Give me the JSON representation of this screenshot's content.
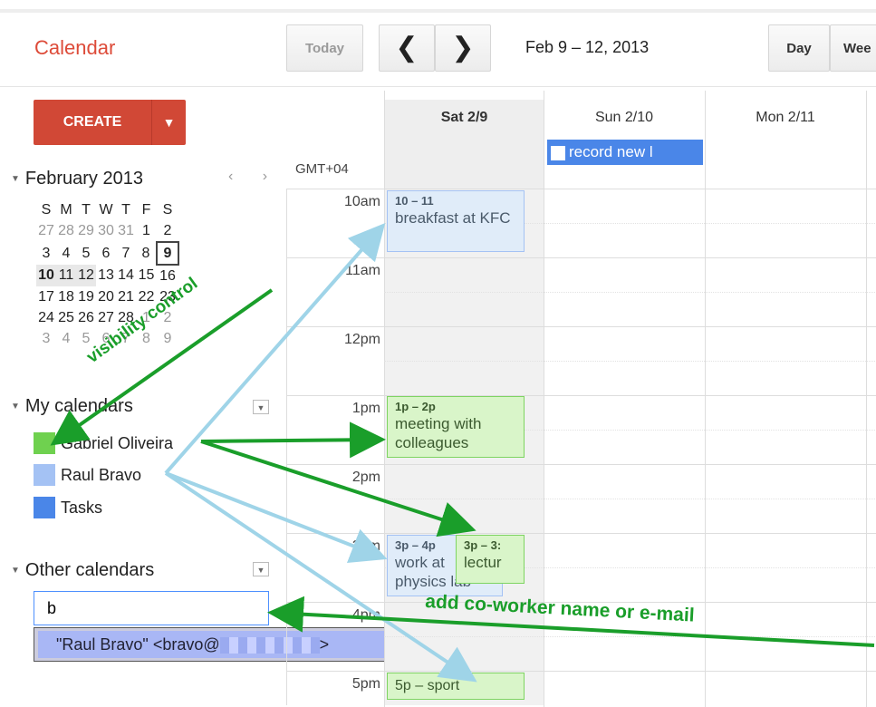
{
  "app": {
    "title": "Calendar"
  },
  "toolbar": {
    "today": "Today",
    "prev_glyph": "❮",
    "next_glyph": "❯",
    "date_range": "Feb 9 – 12, 2013",
    "day": "Day",
    "week": "Wee"
  },
  "create": {
    "label": "CREATE",
    "dropdown_glyph": "▼"
  },
  "mini_calendar": {
    "month": "February 2013",
    "nav": "‹ ›",
    "weekdays": [
      "S",
      "M",
      "T",
      "W",
      "T",
      "F",
      "S"
    ],
    "weeks": [
      [
        "27",
        "28",
        "29",
        "30",
        "31",
        "1",
        "2"
      ],
      [
        "3",
        "4",
        "5",
        "6",
        "7",
        "8",
        "9"
      ],
      [
        "10",
        "11",
        "12",
        "13",
        "14",
        "15",
        "16"
      ],
      [
        "17",
        "18",
        "19",
        "20",
        "21",
        "22",
        "23"
      ],
      [
        "24",
        "25",
        "26",
        "27",
        "28",
        "1",
        "2"
      ],
      [
        "3",
        "4",
        "5",
        "6",
        "7",
        "8",
        "9"
      ]
    ]
  },
  "my_calendars": {
    "title": "My calendars",
    "items": [
      {
        "label": "Gabriel Oliveira",
        "color": "#6fd14f"
      },
      {
        "label": "Raul Bravo",
        "color": "#a4c2f4"
      },
      {
        "label": "Tasks",
        "color": "#4a86e8"
      }
    ]
  },
  "other_calendars": {
    "title": "Other calendars",
    "search_value": "b",
    "suggestion_prefix": "\"Raul Bravo\" <bravo@",
    "suggestion_suffix": ">"
  },
  "grid": {
    "timezone": "GMT+04",
    "days": [
      "Sat 2/9",
      "Sun 2/10",
      "Mon 2/11"
    ],
    "hours": [
      "10am",
      "11am",
      "12pm",
      "1pm",
      "2pm",
      "3pm",
      "4pm",
      "5pm"
    ],
    "allday_event": "record new l",
    "events": [
      {
        "time": "10 – 11",
        "title": "breakfast at KFC"
      },
      {
        "time": "1p – 2p",
        "title": "meeting with colleagues"
      },
      {
        "time": "3p – 4p",
        "title": "work at physics lab"
      },
      {
        "time": "3p – 3:",
        "title": "lectur"
      },
      {
        "time": "5p – sport",
        "title": ""
      }
    ]
  },
  "annotations": {
    "visibility": "visibility control",
    "add_coworker": "add co-worker name or e-mail"
  },
  "colors": {
    "brand": "#dd4b39",
    "create": "#d14836",
    "arrow_green": "#1a9e2a",
    "arrow_blue": "#9fd4e8"
  }
}
